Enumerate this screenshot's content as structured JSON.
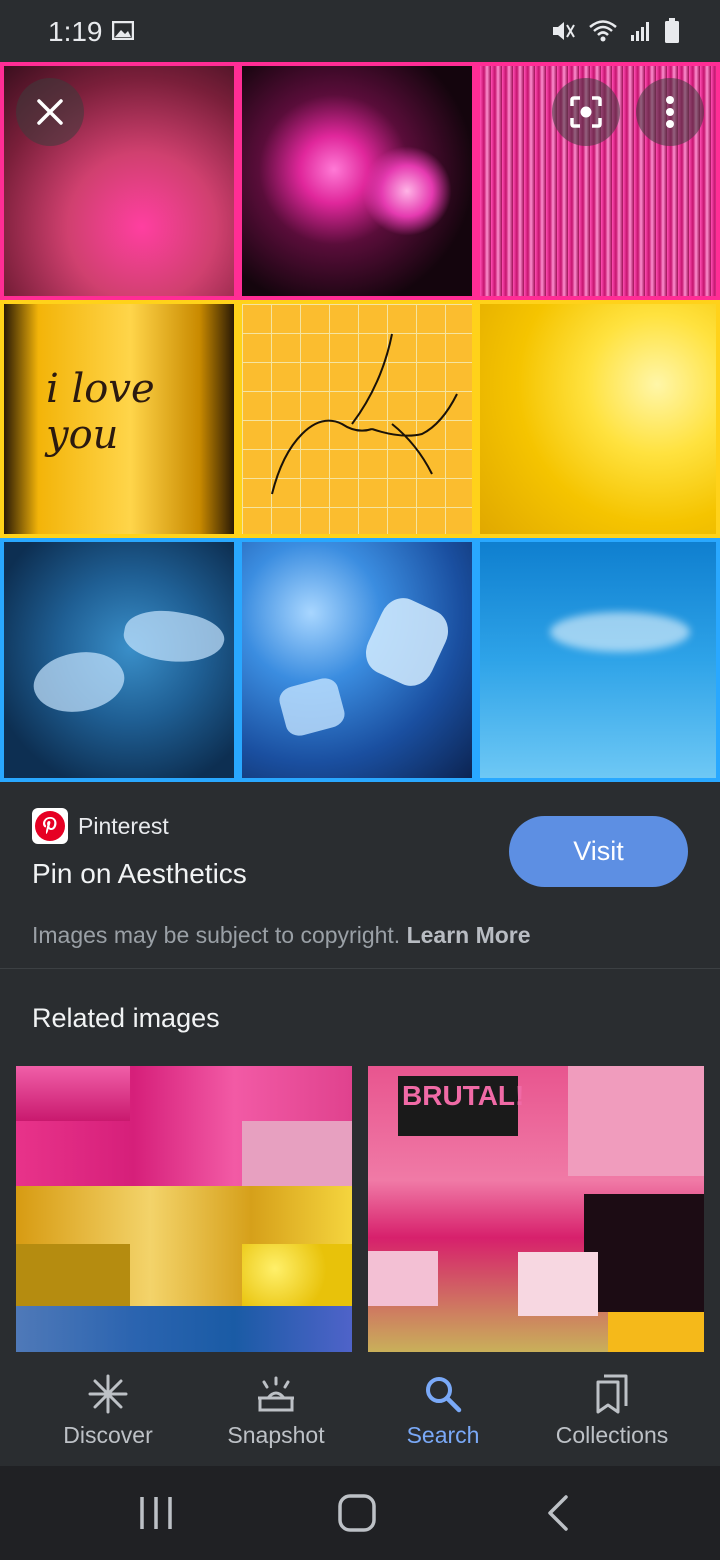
{
  "status_bar": {
    "time": "1:19"
  },
  "hero": {
    "close_label": "close",
    "lens_label": "lens",
    "more_label": "more"
  },
  "info": {
    "source_name": "Pinterest",
    "title": "Pin on Aesthetics",
    "visit_label": "Visit",
    "copyright_text": "Images may be subject to copyright.",
    "learn_more_label": "Learn More"
  },
  "related": {
    "heading": "Related images",
    "overlay_text": "BRUTAL!"
  },
  "nav": {
    "items": [
      {
        "label": "Discover"
      },
      {
        "label": "Snapshot"
      },
      {
        "label": "Search"
      },
      {
        "label": "Collections"
      }
    ],
    "active": "Search"
  },
  "colors": {
    "accent": "#7aa9f7",
    "visit_button": "#5d8fe3",
    "background": "#2a2d30",
    "pink_border": "#ff2d95",
    "yellow_border": "#ffd21a",
    "blue_border": "#29a8ff"
  }
}
